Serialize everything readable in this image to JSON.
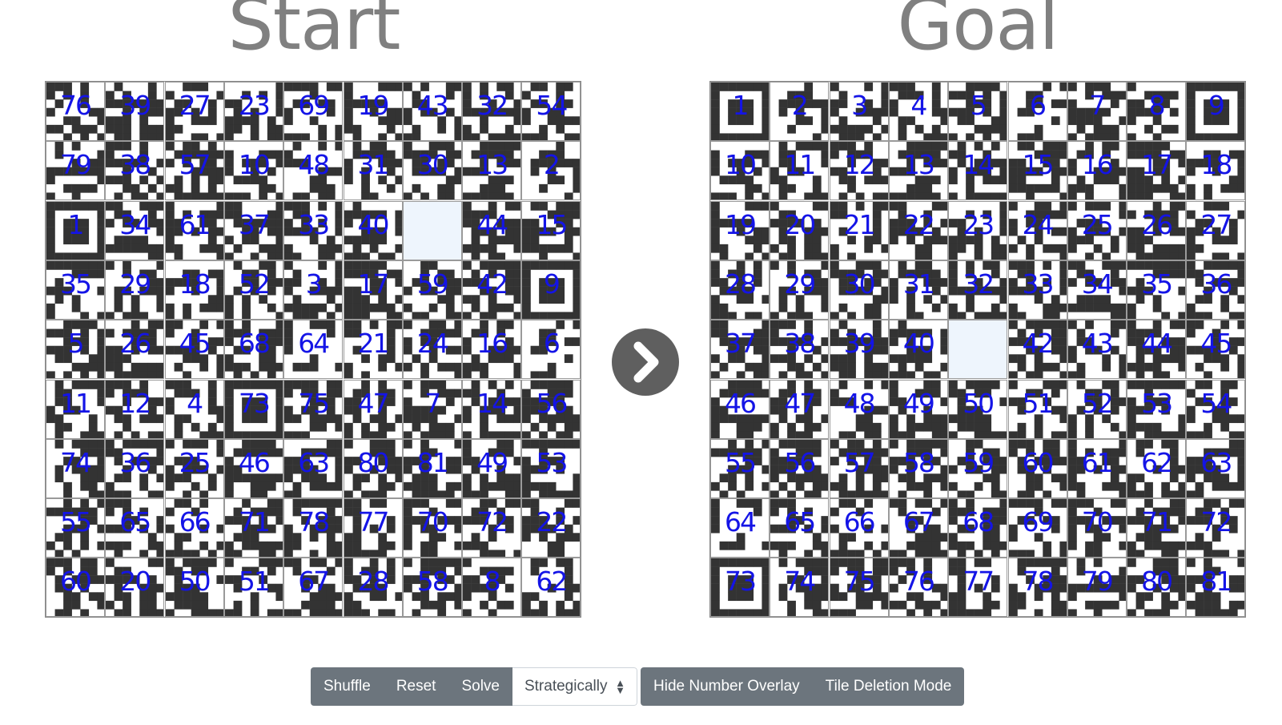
{
  "headings": {
    "start": "Start",
    "goal": "Goal"
  },
  "start_board": {
    "size": 9,
    "tiles": [
      76,
      39,
      27,
      23,
      69,
      19,
      43,
      32,
      54,
      79,
      38,
      57,
      10,
      48,
      31,
      30,
      13,
      2,
      1,
      34,
      61,
      37,
      33,
      40,
      null,
      44,
      15,
      35,
      29,
      18,
      52,
      3,
      17,
      59,
      42,
      9,
      5,
      26,
      45,
      68,
      64,
      21,
      24,
      16,
      6,
      11,
      12,
      4,
      73,
      75,
      47,
      7,
      14,
      56,
      74,
      36,
      25,
      46,
      63,
      80,
      81,
      49,
      53,
      55,
      65,
      66,
      71,
      78,
      77,
      70,
      72,
      22,
      60,
      20,
      50,
      51,
      67,
      28,
      58,
      8,
      62
    ]
  },
  "goal_board": {
    "size": 9,
    "tiles": [
      1,
      2,
      3,
      4,
      5,
      6,
      7,
      8,
      9,
      10,
      11,
      12,
      13,
      14,
      15,
      16,
      17,
      18,
      19,
      20,
      21,
      22,
      23,
      24,
      25,
      26,
      27,
      28,
      29,
      30,
      31,
      32,
      33,
      34,
      35,
      36,
      37,
      38,
      39,
      40,
      null,
      42,
      43,
      44,
      45,
      46,
      47,
      48,
      49,
      50,
      51,
      52,
      53,
      54,
      55,
      56,
      57,
      58,
      59,
      60,
      61,
      62,
      63,
      64,
      65,
      66,
      67,
      68,
      69,
      70,
      71,
      72,
      73,
      74,
      75,
      76,
      77,
      78,
      79,
      80,
      81
    ]
  },
  "arrow_icon": "chevron-right-icon",
  "toolbar": {
    "shuffle": "Shuffle",
    "reset": "Reset",
    "solve": "Solve",
    "strategy_selected": "Strategically",
    "hide_overlay": "Hide Number Overlay",
    "tile_deletion": "Tile Deletion Mode"
  },
  "colors": {
    "dark_module": "#333333",
    "blank_tile": "#eef5fd",
    "number": "#1414e6",
    "button": "#6c757d"
  }
}
